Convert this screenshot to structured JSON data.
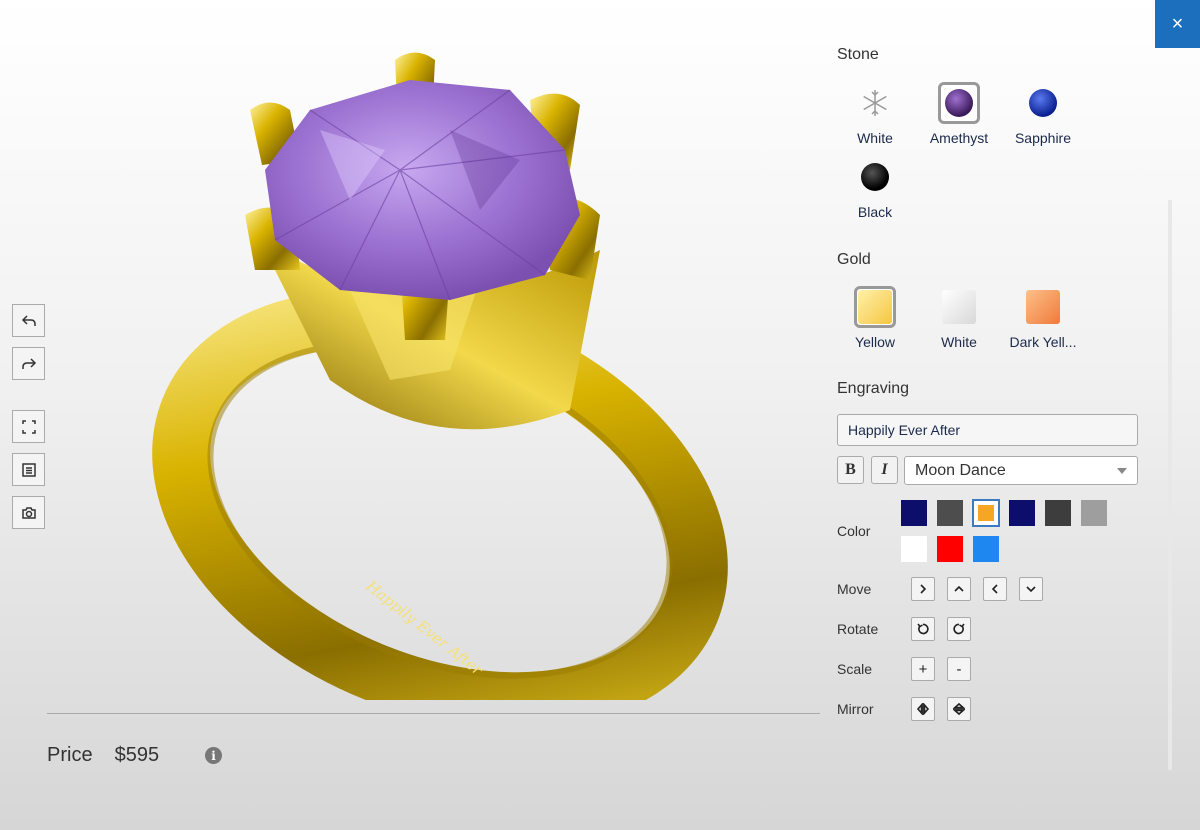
{
  "close": {
    "label": "×"
  },
  "viewer": {
    "engraving_text_on_ring": "Happily Ever After",
    "tools": [
      {
        "name": "undo-button",
        "icon": "undo-icon"
      },
      {
        "name": "redo-button",
        "icon": "redo-icon"
      },
      {
        "name": "fullscreen-button",
        "icon": "fullscreen-icon"
      },
      {
        "name": "details-button",
        "icon": "list-icon"
      },
      {
        "name": "snapshot-button",
        "icon": "camera-icon"
      }
    ]
  },
  "price": {
    "label": "Price",
    "value": "$595",
    "info_icon": "i"
  },
  "stone": {
    "title": "Stone",
    "selected": "Amethyst",
    "options": [
      {
        "label": "White",
        "color": "#e8e8e8"
      },
      {
        "label": "Amethyst",
        "color": "#4a2a6a"
      },
      {
        "label": "Sapphire",
        "color": "#1a3fa8"
      },
      {
        "label": "Black",
        "color": "#111111"
      }
    ]
  },
  "gold": {
    "title": "Gold",
    "selected": "Yellow",
    "options": [
      {
        "label": "Yellow",
        "color_a": "#fbe07a",
        "color_b": "#f5c642"
      },
      {
        "label": "White",
        "color_a": "#ffffff",
        "color_b": "#dedede"
      },
      {
        "label": "Dark Yell...",
        "color_a": "#fbb07a",
        "color_b": "#f07a3a"
      }
    ]
  },
  "engraving": {
    "title": "Engraving",
    "text": "Happily Ever After",
    "bold_label": "B",
    "italic_label": "I",
    "font": "Moon Dance",
    "color_label": "Color",
    "colors": [
      "#0d0d6b",
      "#4d4d4d",
      "#f5a623",
      "#0d0d6b",
      "#3d3d3d",
      "#9e9e9e",
      "#ffffff",
      "#ff0000",
      "#1e88f0"
    ],
    "selected_color_index": 2,
    "move_label": "Move",
    "rotate_label": "Rotate",
    "scale_label": "Scale",
    "scale_plus": "+",
    "scale_minus": "-",
    "mirror_label": "Mirror"
  }
}
